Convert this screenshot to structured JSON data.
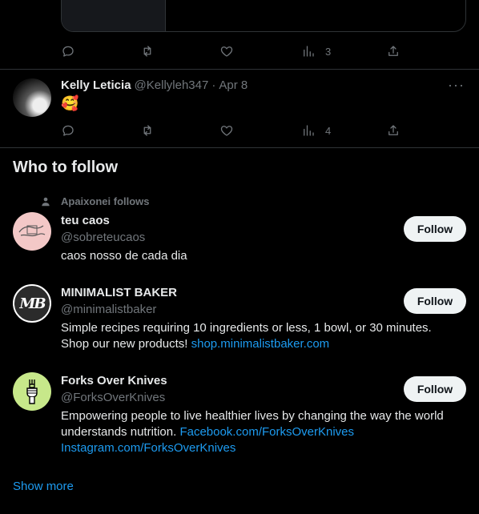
{
  "prev_tweet": {
    "actions": {
      "reply": "",
      "repost": "",
      "like": "",
      "views": "3",
      "share": ""
    }
  },
  "tweet": {
    "author_name": "Kelly Leticia",
    "handle": "@Kellyleh347",
    "separator": "·",
    "date": "Apr 8",
    "text": "🥰",
    "more": "···",
    "actions": {
      "reply": "",
      "repost": "",
      "like": "",
      "views": "4",
      "share": ""
    }
  },
  "who_to_follow": {
    "title": "Who to follow",
    "social_context": "Apaixonei follows",
    "follow_label": "Follow",
    "show_more": "Show more",
    "suggestions": [
      {
        "name": "teu caos",
        "handle": "@sobreteucaos",
        "bio": "caos nosso de cada dia"
      },
      {
        "name": "MINIMALIST BAKER",
        "handle": "@minimalistbaker",
        "avatar_text": "MB",
        "bio_line1": "Simple recipes requiring 10 ingredients or less, 1 bowl, or 30 minutes.",
        "bio_line2_text": "Shop our new products! ",
        "bio_line2_link": "shop.minimalistbaker.com"
      },
      {
        "name": "Forks Over Knives",
        "handle": "@ForksOverKnives",
        "bio_line1": "Empowering people to live healthier lives by changing the way the world",
        "bio_line2_text": "understands nutrition. ",
        "bio_line2_link": "Facebook.com/ForksOverKnives",
        "bio_line3_link": "Instagram.com/ForksOverKnives"
      }
    ]
  },
  "colors": {
    "background": "#000000",
    "text_primary": "#e7e9ea",
    "text_secondary": "#71767b",
    "link": "#1d9bf0",
    "divider": "#2f3336",
    "follow_button_bg": "#eff3f4"
  },
  "icons": [
    "reply-icon",
    "repost-icon",
    "like-icon",
    "views-icon",
    "share-icon",
    "more-icon",
    "person-icon"
  ]
}
